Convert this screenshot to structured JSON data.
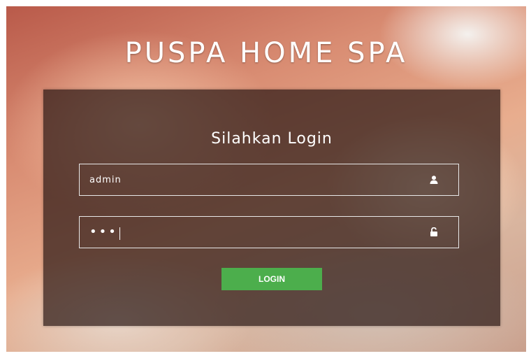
{
  "app": {
    "title": "PUSPA HOME SPA"
  },
  "login": {
    "heading": "Silahkan Login",
    "username": {
      "value": "admin",
      "icon": "user-icon"
    },
    "password": {
      "masked_value": "•••",
      "icon": "lock-icon"
    },
    "submit_label": "LOGIN"
  },
  "colors": {
    "button": "#4cae4c",
    "panel": "#3a1f18",
    "text": "#ffffff"
  }
}
